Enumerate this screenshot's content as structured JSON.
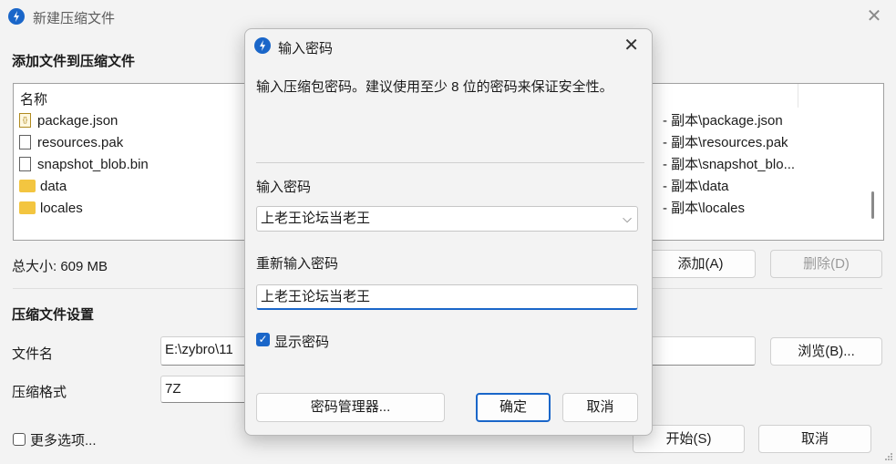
{
  "main": {
    "title": "新建压缩文件",
    "section_add": "添加文件到压缩文件",
    "list_header": "名称",
    "files": [
      {
        "name": "package.json",
        "type": "json"
      },
      {
        "name": "resources.pak",
        "type": "file"
      },
      {
        "name": "snapshot_blob.bin",
        "type": "file"
      },
      {
        "name": "data",
        "type": "folder"
      },
      {
        "name": "locales",
        "type": "folder"
      }
    ],
    "dest_paths": [
      "- 副本\\package.json",
      "- 副本\\resources.pak",
      "- 副本\\snapshot_blo...",
      "- 副本\\data",
      "- 副本\\locales"
    ],
    "total_size": "总大小: 609 MB",
    "add_button": "添加(A)",
    "delete_button": "删除(D)",
    "section_settings": "压缩文件设置",
    "filename_label": "文件名",
    "filename_value": "E:\\zybro\\11",
    "browse_button": "浏览(B)...",
    "format_label": "压缩格式",
    "format_value": "7Z",
    "more_options": "更多选项...",
    "start_button": "开始(S)",
    "cancel_button": "取消"
  },
  "dialog": {
    "title": "输入密码",
    "description": "输入压缩包密码。建议使用至少 8 位的密码来保证安全性。",
    "password_label": "输入密码",
    "password_value": "上老王论坛当老王",
    "reenter_label": "重新输入密码",
    "reenter_value": "上老王论坛当老王",
    "show_password_label": "显示密码",
    "show_password_checked": true,
    "manager_button": "密码管理器...",
    "ok_button": "确定",
    "cancel_button": "取消"
  }
}
